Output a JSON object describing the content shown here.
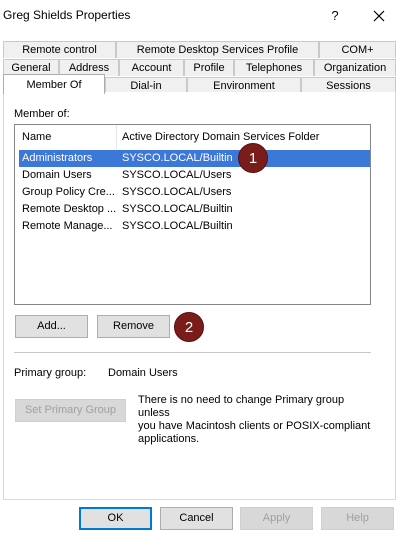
{
  "window": {
    "title": "Greg Shields Properties",
    "help_glyph": "?"
  },
  "tabs": {
    "row1": [
      "Remote control",
      "Remote Desktop Services Profile",
      "COM+"
    ],
    "row2": [
      "General",
      "Address",
      "Account",
      "Profile",
      "Telephones",
      "Organization"
    ],
    "row3": [
      "Member Of",
      "Dial-in",
      "Environment",
      "Sessions"
    ],
    "active": "Member Of"
  },
  "member_of": {
    "label": "Member of:",
    "columns": [
      "Name",
      "Active Directory Domain Services Folder"
    ],
    "rows": [
      {
        "name": "Administrators",
        "folder": "SYSCO.LOCAL/Builtin",
        "selected": true
      },
      {
        "name": "Domain Users",
        "folder": "SYSCO.LOCAL/Users",
        "selected": false
      },
      {
        "name": "Group Policy Cre...",
        "folder": "SYSCO.LOCAL/Users",
        "selected": false
      },
      {
        "name": "Remote Desktop ...",
        "folder": "SYSCO.LOCAL/Builtin",
        "selected": false
      },
      {
        "name": "Remote Manage...",
        "folder": "SYSCO.LOCAL/Builtin",
        "selected": false
      }
    ]
  },
  "buttons": {
    "add": "Add...",
    "remove": "Remove",
    "set_primary": "Set Primary Group",
    "ok": "OK",
    "cancel": "Cancel",
    "apply": "Apply",
    "help": "Help"
  },
  "primary_group": {
    "label": "Primary group:",
    "value": "Domain Users",
    "note_lines": [
      "There is no need to change Primary group unless",
      "you have Macintosh clients or POSIX-compliant",
      "applications."
    ]
  },
  "annotations": [
    "1",
    "2"
  ],
  "colors": {
    "selection": "#3c78d8",
    "badge": "#7a1c1a",
    "default_button_border": "#0078d7"
  }
}
